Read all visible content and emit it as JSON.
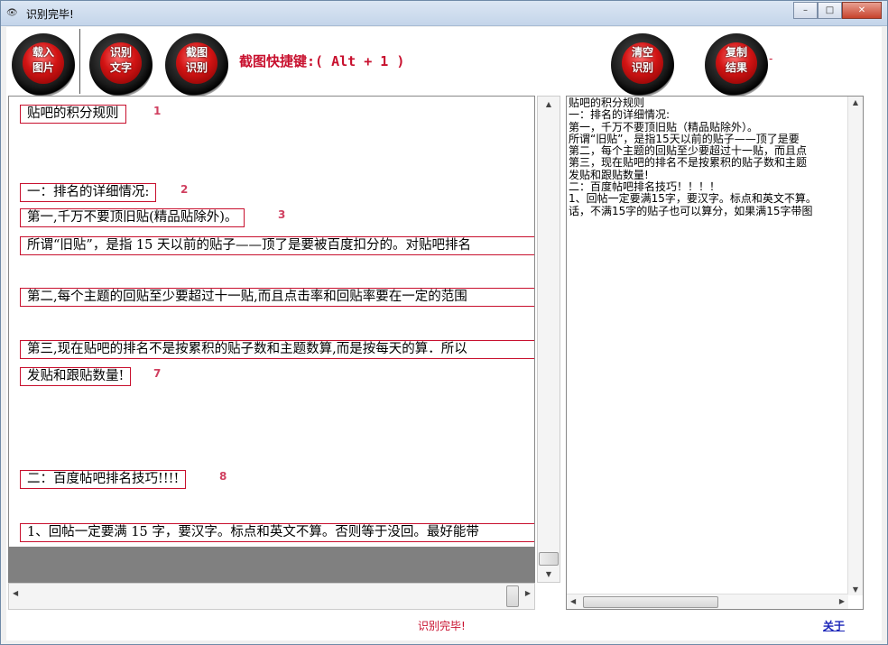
{
  "window": {
    "title": "识别完毕!",
    "title_icon": "eye-icon",
    "controls": {
      "minimize": "–",
      "maximize": "□",
      "close": "✕"
    }
  },
  "toolbar": {
    "load_image": {
      "line1": "载入",
      "line2": "图片"
    },
    "recognize_text": {
      "line1": "识别",
      "line2": "文字"
    },
    "capture_recognize": {
      "line1": "截图",
      "line2": "识别"
    },
    "hotkey_label": "截图快捷键:( Alt + 1 )",
    "clear": {
      "line1": "清空",
      "line2": "识别"
    },
    "copy": {
      "line1": "复制",
      "line2": "结果"
    },
    "dash": "-"
  },
  "source": {
    "lines": [
      {
        "text": "贴吧的积分规则",
        "num": "1"
      },
      {
        "text": "一：排名的详细情况:",
        "num": "2"
      },
      {
        "text": "第一,千万不要顶旧贴(精品贴除外)。",
        "num": "3"
      },
      {
        "text": "所谓“旧贴”，是指 15 天以前的贴子——顶了是要被百度扣分的。对贴吧排名",
        "num": ""
      },
      {
        "text": "第二,每个主题的回贴至少要超过十一贴,而且点击率和回贴率要在一定的范围",
        "num": ""
      },
      {
        "text": "第三,现在贴吧的排名不是按累积的贴子数和主题数算,而是按每天的算．所以",
        "num": ""
      },
      {
        "text": "发贴和跟贴数量!",
        "num": "7"
      },
      {
        "text": "二：百度帖吧排名技巧!!!!",
        "num": "8"
      },
      {
        "text": "1、回帖一定要满 15 字，要汉字。标点和英文不算。否则等于没回。最好能带",
        "num": ""
      }
    ]
  },
  "result": {
    "text": "贴吧的积分规则\n一：排名的详细情况:\n第一，千万不要顶旧贴（精品贴除外）。\n所谓“旧贴”，是指15天以前的贴子——顶了是要\n第二，每个主题的回贴至少要超过十一贴，而且点\n第三，现在贴吧的排名不是按累积的贴子数和主题\n发贴和跟贴数量!\n二：百度帖吧排名技巧！！！！\n1、回帖一定要满15字，要汉字。标点和英文不算。\n话，不满15字的贴子也可以算分，如果满15字带图"
  },
  "status": {
    "text": "识别完毕!",
    "about": "关于"
  }
}
